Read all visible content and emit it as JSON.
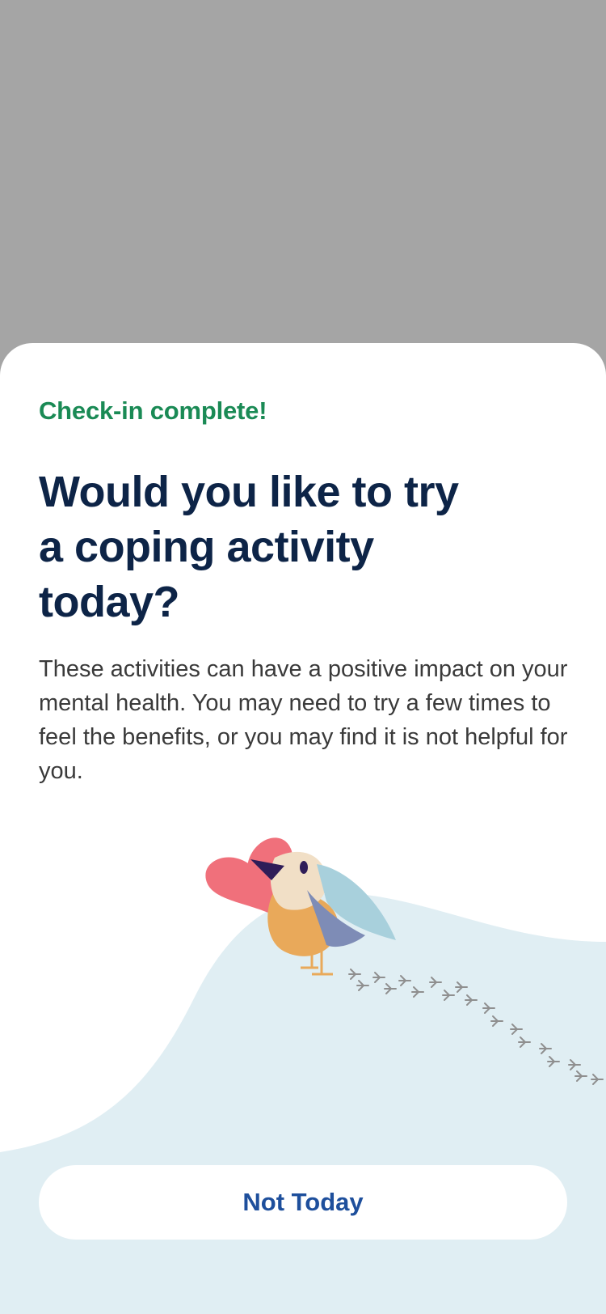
{
  "sheet": {
    "eyebrow": "Check-in complete!",
    "headline_lines": [
      "Would you like to try",
      "a coping activity",
      "today?"
    ],
    "body": "These activities can have a positive impact on your mental health. You may need to try a few times to feel the benefits, or you may find it is not helpful for you.",
    "illustration_icons": [
      "heart-icon",
      "bird-icon",
      "footprints-icon",
      "hill-shape"
    ],
    "not_today_label": "Not Today"
  },
  "colors": {
    "overlay": "#a5a5a5",
    "eyebrow": "#1a8a55",
    "headline": "#0d2447",
    "body": "#3a3a3a",
    "hill": "#e0eef3",
    "button_text": "#1e4f9c",
    "heart": "#f0707b",
    "bird_wing": "#a8d0dc",
    "bird_belly": "#e9a95a",
    "bird_head": "#f1dfc6"
  }
}
